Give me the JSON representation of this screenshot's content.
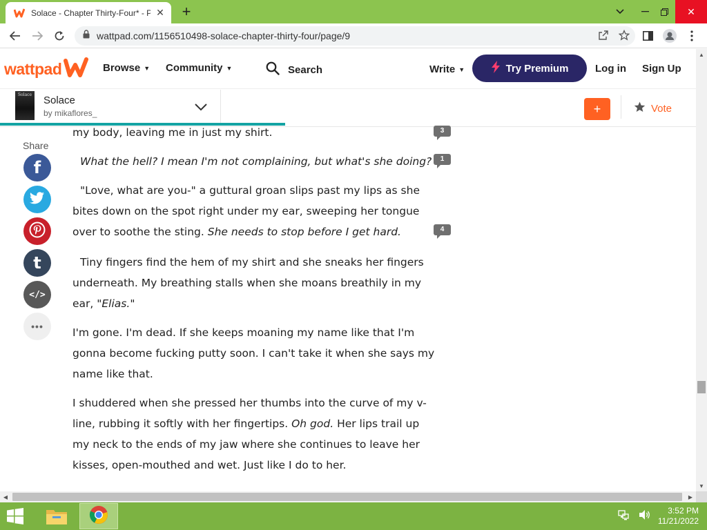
{
  "browser": {
    "tab_title": "Solace - Chapter Thirty-Four* - P",
    "new_tab": "+",
    "url": "wattpad.com/1156510498-solace-chapter-thirty-four/page/9"
  },
  "header": {
    "logo_text": "wattpad",
    "browse": "Browse",
    "community": "Community",
    "search": "Search",
    "write": "Write",
    "premium": "Try Premium",
    "login": "Log in",
    "signup": "Sign Up",
    "brand_color": "#ff6122",
    "premium_color": "#2a2666"
  },
  "story": {
    "cover_text": "Solace",
    "title": "Solace",
    "author": "by mikaflores_",
    "add_label": "+",
    "vote_label": "Vote",
    "read_progress": 0.41
  },
  "share": {
    "label": "Share",
    "items": [
      {
        "name": "facebook",
        "glyph": "f",
        "color": "#3b5998"
      },
      {
        "name": "twitter",
        "glyph": "twitter-bird-icon",
        "color": "#29a9e1"
      },
      {
        "name": "pinterest",
        "glyph": "P",
        "color": "#c8202b"
      },
      {
        "name": "tumblr",
        "glyph": "t",
        "color": "#35465c"
      },
      {
        "name": "embed",
        "glyph": "</>",
        "color": "#585858"
      },
      {
        "name": "more",
        "glyph": "•••",
        "color": "#efefef"
      }
    ]
  },
  "paragraphs": {
    "p1": "my body, leaving me in just my shirt.",
    "p2": "What the hell? I mean I'm not complaining, but what's she doing?",
    "p3a": "\"Love, what are you-\" a guttural groan slips past my lips as she bites down on the spot right under my ear, sweeping her tongue over to soothe the sting. ",
    "p3b": "She needs to stop before I get hard.",
    "p4a": "Tiny fingers find the hem of my shirt and she sneaks her fingers underneath. My breathing stalls when she moans breathily in my ear, \"",
    "p4b": "Elias.",
    "p4c": "\"",
    "p5": "I'm gone. I'm dead. If she keeps moaning my name like that I'm gonna become fucking putty soon. I can't take it when she says my name like that.",
    "p6a": "I shuddered when she pressed her thumbs into the curve of my v-line, rubbing it softly with her fingertips. ",
    "p6b": "Oh god.",
    "p6c": " Her lips trail up my neck to the ends of my jaw where she continues to leave her kisses, open-mouthed and wet. Just like I do to her."
  },
  "comments": {
    "c1": "3",
    "c2": "1",
    "c3": "4"
  },
  "taskbar": {
    "time": "3:52 PM",
    "date": "11/21/2022",
    "color": "#7cb342"
  }
}
